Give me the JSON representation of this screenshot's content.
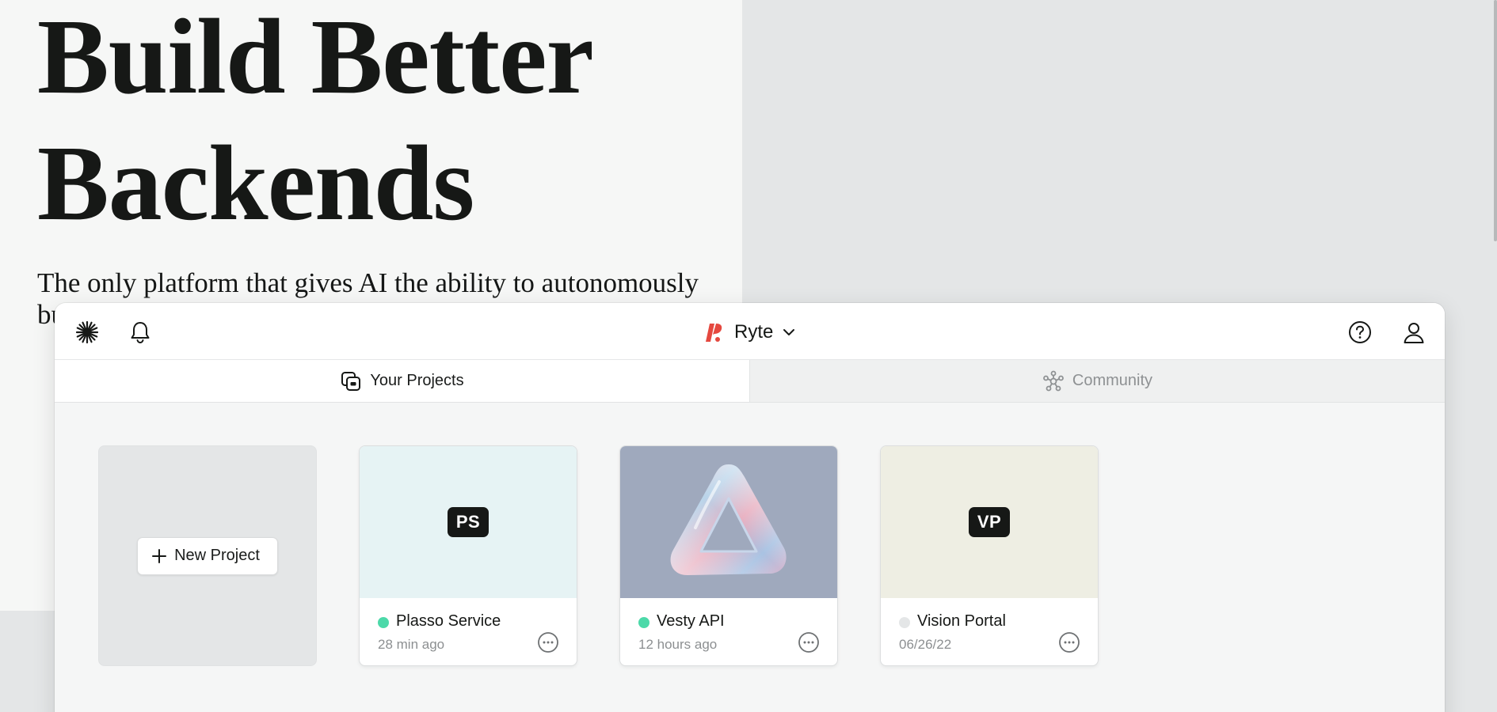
{
  "hero": {
    "title": "Build Better Backends",
    "subtitle": "The only platform that gives AI the ability to autonomously bu"
  },
  "app": {
    "topbar": {
      "left_icons": [
        "starburst-icon",
        "bell-icon"
      ],
      "right_icons": [
        "help-circle-icon",
        "user-icon"
      ],
      "workspace": {
        "name": "Ryte",
        "brand_color": "#e5483f"
      }
    },
    "tabs": [
      {
        "label": "Your Projects",
        "icon": "projects-icon",
        "active": true
      },
      {
        "label": "Community",
        "icon": "community-icon",
        "active": false
      }
    ],
    "new_project_label": "New Project",
    "projects": [
      {
        "name": "Plasso Service",
        "badge": "PS",
        "time": "28 min ago",
        "status_color": "#4cd9a9",
        "thumb_color": "#e6f3f4"
      },
      {
        "name": "Vesty API",
        "badge": "",
        "thumb_image": "iridescent-triangle",
        "time": "12 hours ago",
        "status_color": "#4cd9a9",
        "thumb_color": "#9fa9bd"
      },
      {
        "name": "Vision Portal",
        "badge": "VP",
        "time": "06/26/22",
        "status_color": "#e4e6e7",
        "thumb_color": "#eeeee3"
      }
    ]
  }
}
